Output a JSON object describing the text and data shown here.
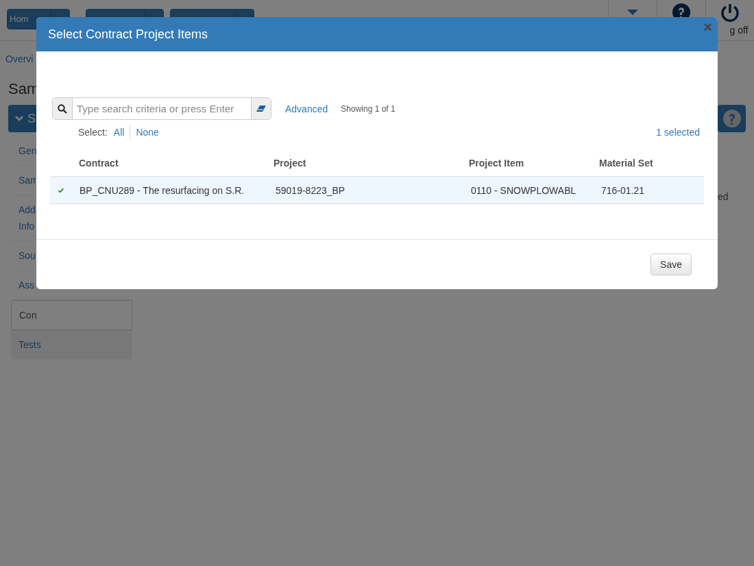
{
  "background": {
    "nav_label": "Hom",
    "logoff": "g off",
    "breadcrumb": "Overvi",
    "heading": "Sam",
    "section": "S",
    "sidebar": [
      {
        "label": "Gen",
        "selected": false
      },
      {
        "label": "Sam",
        "selected": false
      },
      {
        "label": "Add\nInfo",
        "selected": false
      },
      {
        "label": "Sou",
        "selected": false
      },
      {
        "label": "Ass",
        "selected": false
      },
      {
        "label": "Con",
        "selected": true
      },
      {
        "label": "Tests",
        "selected": false
      }
    ],
    "side_text": "ed"
  },
  "dialog": {
    "title": "Select Contract Project Items",
    "close": "×",
    "search": {
      "placeholder": "Type search criteria or press Enter"
    },
    "advanced": "Advanced",
    "showing": "Showing 1 of 1",
    "select_label": "Select:",
    "select_all": "All",
    "select_none": "None",
    "selected_count": "1 selected",
    "columns": [
      "Contract",
      "Project",
      "Project Item",
      "Material Set"
    ],
    "rows": [
      {
        "selected": true,
        "cells": [
          "BP_CNU289 - The resurfacing on S.R.",
          "59019-8223_BP",
          "0110 - SNOWPLOWABL",
          "716-01.21"
        ]
      }
    ],
    "save": "Save"
  }
}
